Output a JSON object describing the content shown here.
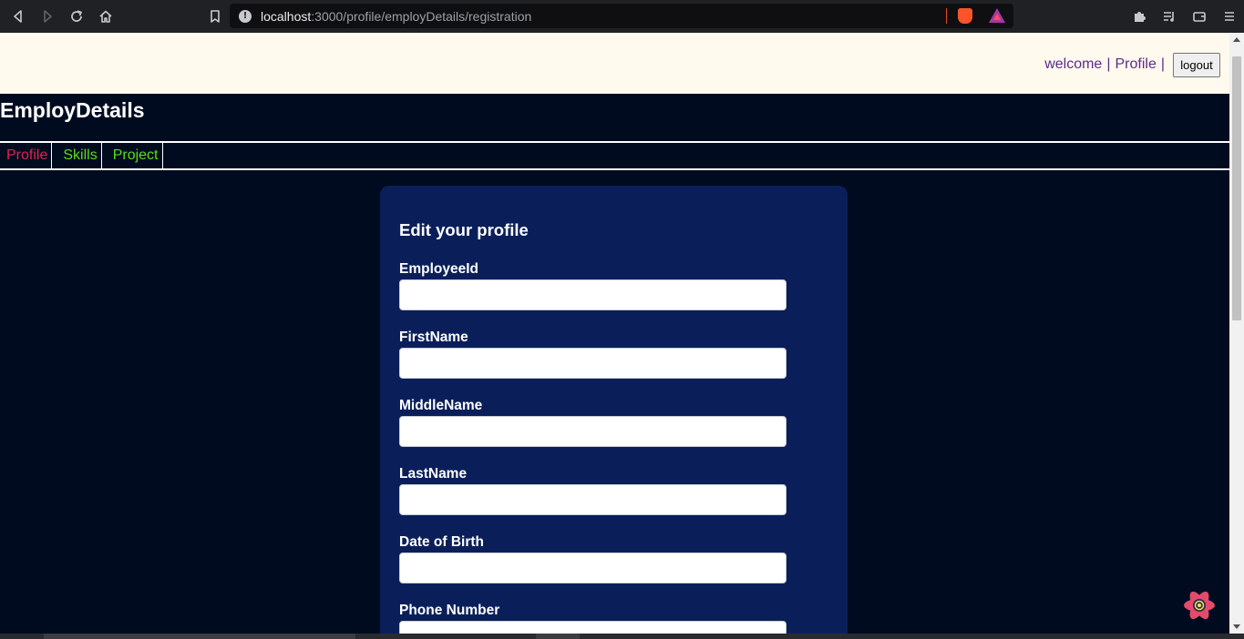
{
  "browser": {
    "url_host": "localhost",
    "url_path": ":3000/profile/employDetails/registration"
  },
  "topbar": {
    "welcome": "welcome",
    "separator": "|",
    "profile": "Profile",
    "logout": "logout"
  },
  "app": {
    "brand": "EmployDetails"
  },
  "tabs": [
    {
      "label": "Profile"
    },
    {
      "label": "Skills"
    },
    {
      "label": "Project"
    }
  ],
  "form": {
    "title": "Edit your profile",
    "fields": [
      {
        "label": "EmployeeId",
        "value": ""
      },
      {
        "label": "FirstName",
        "value": ""
      },
      {
        "label": "MiddleName",
        "value": ""
      },
      {
        "label": "LastName",
        "value": ""
      },
      {
        "label": "Date of Birth",
        "value": ""
      },
      {
        "label": "Phone Number",
        "value": ""
      }
    ]
  },
  "colors": {
    "page_bg": "#000b20",
    "card_bg": "#0a1f5a",
    "topbar_bg": "#fff9ee",
    "active_tab": "#e3224f",
    "inactive_tab": "#5bdf12"
  },
  "icons": [
    "back-icon",
    "forward-icon",
    "reload-icon",
    "home-icon",
    "bookmark-icon",
    "info-icon",
    "brave-shield-icon",
    "brave-rewards-icon",
    "extensions-icon",
    "playlist-icon",
    "wallet-icon",
    "menu-icon",
    "react-devtools-icon"
  ]
}
